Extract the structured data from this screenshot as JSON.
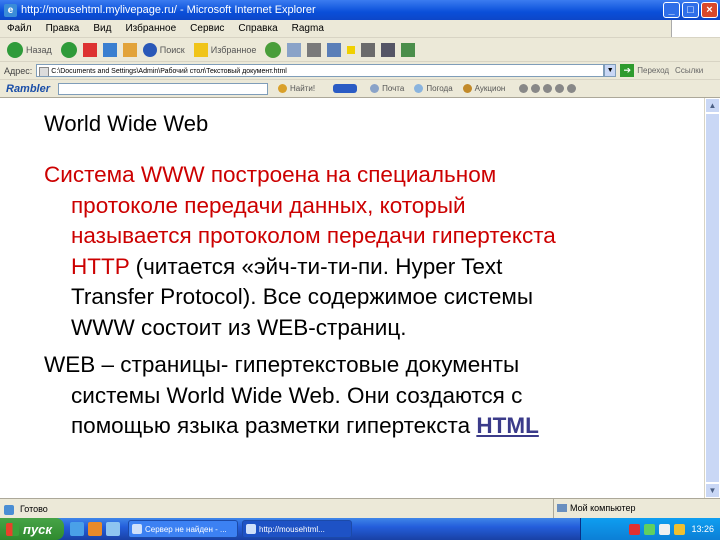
{
  "window": {
    "title": "http://mousehtml.mylivepage.ru/ - Microsoft Internet Explorer",
    "icon_letter": "e",
    "minimize": "_",
    "maximize": "□",
    "close": "×"
  },
  "menu": [
    "Файл",
    "Правка",
    "Вид",
    "Избранное",
    "Сервис",
    "Справка",
    "Ragma"
  ],
  "toolbar": {
    "back": "Назад",
    "search": "Поиск",
    "favorites": "Избранное"
  },
  "address": {
    "label": "Адрес:",
    "value": "C:\\Documents and Settings\\Admin\\Рабочий стол\\Текстовый документ.html",
    "go": "Переход",
    "links": "Ссылки"
  },
  "rambler": {
    "logo": "Rambler",
    "find": "Найти!",
    "items": [
      "Почта",
      "Погода",
      "Аукцион"
    ]
  },
  "content": {
    "heading": "World Wide Web",
    "p1_lines": [
      "Система WWW построена на специальном",
      "протоколе передачи данных, который",
      "называется протоколом передачи гипертекста",
      "HTTP"
    ],
    "p1_tail": " (читается «эйч-ти-ти-пи. Hyper Text",
    "p1_rest": [
      "Transfer Protocol). Все содержимое системы",
      "WWW состоит из WEB-страниц."
    ],
    "p2_lines": [
      "WEB – страницы- гипертекстовые документы",
      "системы World Wide Web. Они создаются с"
    ],
    "p2_last": "помощью языка разметки гипертекста ",
    "p2_link": "HTML"
  },
  "status": {
    "left": "Готово",
    "right": "Мой компьютер"
  },
  "taskbar": {
    "start": "пуск",
    "tasks": [
      "Сервер не найден - ...",
      "http://mousehtml..."
    ],
    "clock": "13:26"
  },
  "colors": {
    "accent_red": "#cc0000",
    "link": "#3b3b8a"
  }
}
